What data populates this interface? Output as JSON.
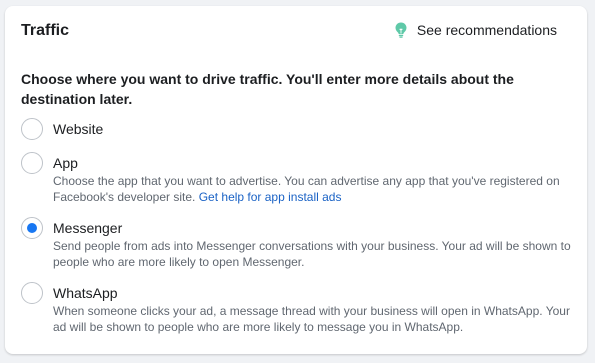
{
  "card": {
    "title": "Traffic",
    "recommendations_label": "See recommendations",
    "recommendations_icon": "lightbulb-icon",
    "icon_color": "#5fc9a8"
  },
  "prompt": "Choose where you want to drive traffic. You'll enter more details about the destination later.",
  "options": [
    {
      "label": "Website",
      "selected": false,
      "description": ""
    },
    {
      "label": "App",
      "selected": false,
      "description": "Choose the app that you want to advertise. You can advertise any app that you've registered on Facebook's developer site.",
      "link_text": "Get help for app install ads"
    },
    {
      "label": "Messenger",
      "selected": true,
      "description": "Send people from ads into Messenger conversations with your business. Your ad will be shown to people who are more likely to open Messenger."
    },
    {
      "label": "WhatsApp",
      "selected": false,
      "description": "When someone clicks your ad, a message thread with your business will open in WhatsApp. Your ad will be shown to people who are more likely to message you in WhatsApp."
    }
  ],
  "colors": {
    "accent": "#1877f2",
    "link": "#1a62c5",
    "secondary_text": "#606770"
  }
}
